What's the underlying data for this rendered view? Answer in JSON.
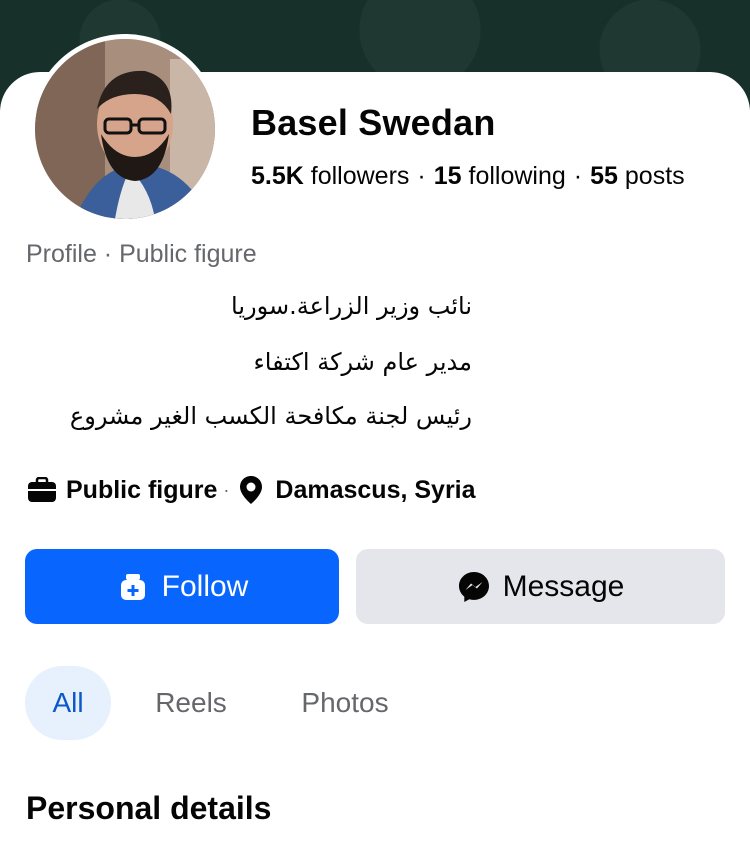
{
  "profile": {
    "name": "Basel Swedan",
    "followers_count": "5.5K",
    "followers_label": "followers",
    "following_count": "15",
    "following_label": "following",
    "posts_count": "55",
    "posts_label": "posts",
    "separator": "·",
    "category": "Profile · Public figure"
  },
  "bio": {
    "lines": [
      "نائب وزير الزراعة.سوريا",
      "مدير عام شركة اكتفاء",
      "رئيس لجنة مكافحة الكسب الغير مشروع"
    ]
  },
  "meta": {
    "type_label": "Public figure",
    "type_icon": "briefcase-icon",
    "separator": "·",
    "location_label": "Damascus, Syria",
    "location_icon": "location-pin-icon"
  },
  "actions": {
    "follow_label": "Follow",
    "follow_icon": "follow-icon",
    "message_label": "Message",
    "message_icon": "messenger-icon"
  },
  "tabs": [
    {
      "label": "All",
      "active": true
    },
    {
      "label": "Reels",
      "active": false
    },
    {
      "label": "Photos",
      "active": false
    }
  ],
  "sections": {
    "personal_details_title": "Personal details"
  },
  "colors": {
    "primary": "#0866ff",
    "secondary_button": "#e4e6eb",
    "active_tab_bg": "#e7f0fd",
    "cover": "#17302a"
  }
}
